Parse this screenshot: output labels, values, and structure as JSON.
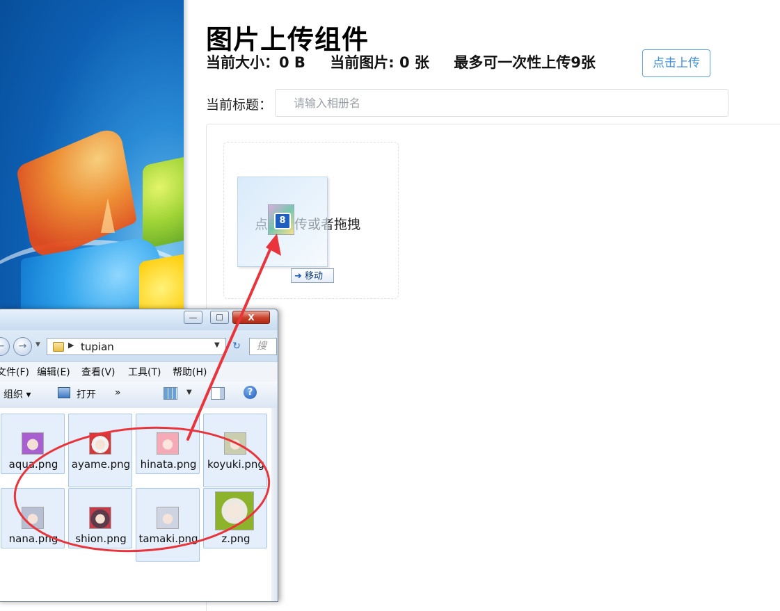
{
  "page": {
    "title": "图片上传组件",
    "current_size": "当前大小：0 B",
    "current_count": "当前图片: 0 张",
    "max_text": "最多可一次性上传9张",
    "upload_button_label": "点击上传",
    "title_label": "当前标题：",
    "title_placeholder": "请输入相册名",
    "drop_text": "点击上传或者拖拽"
  },
  "drag": {
    "count": "8",
    "tip": "移动"
  },
  "explorer": {
    "path": "tupian",
    "search_placeholder": "搜",
    "window_buttons": {
      "minimize": "—",
      "maximize": "☐",
      "close": "X"
    },
    "menu": [
      "文件(F)",
      "编辑(E)",
      "查看(V)",
      "工具(T)",
      "帮助(H)"
    ],
    "toolbar": {
      "organize": "组织 ▾",
      "open": "打开",
      "more": "»",
      "help": "?"
    },
    "files": [
      {
        "name": "aqua.png"
      },
      {
        "name": "ayame.png"
      },
      {
        "name": "hinata.png"
      },
      {
        "name": "koyuki.png"
      },
      {
        "name": "nana.png"
      },
      {
        "name": "shion.png"
      },
      {
        "name": "tamaki.png"
      },
      {
        "name": "z.png"
      }
    ]
  },
  "colors": {
    "accent": "#3c8ee0",
    "annotation": "#e8343a"
  }
}
